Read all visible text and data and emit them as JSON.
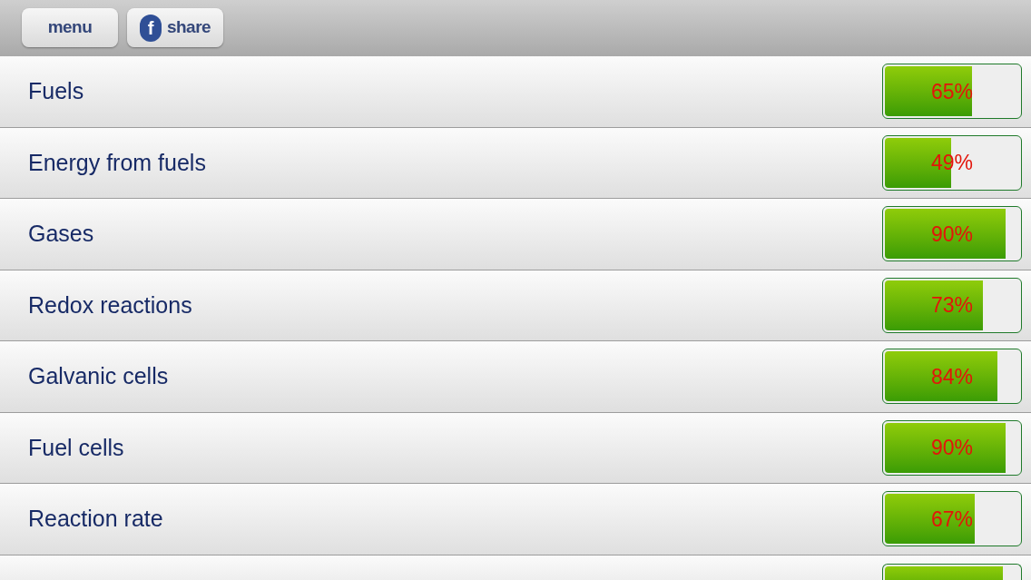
{
  "toolbar": {
    "buttons": [
      {
        "kind": "text",
        "label": "menu"
      },
      {
        "kind": "share",
        "icon": "f",
        "label": "share"
      }
    ]
  },
  "topics": [
    {
      "name": "Fuels",
      "level": 0.65,
      "reading": "65%"
    },
    {
      "name": "Energy from fuels",
      "level": 0.49,
      "reading": "49%"
    },
    {
      "name": "Gases",
      "level": 0.9,
      "reading": "90%"
    },
    {
      "name": "Redox reactions",
      "level": 0.73,
      "reading": "73%"
    },
    {
      "name": "Galvanic cells",
      "level": 0.84,
      "reading": "84%"
    },
    {
      "name": "Fuel cells",
      "level": 0.9,
      "reading": "90%"
    },
    {
      "name": "Reaction rate",
      "level": 0.67,
      "reading": "67%"
    },
    {
      "level": 0.88
    }
  ]
}
